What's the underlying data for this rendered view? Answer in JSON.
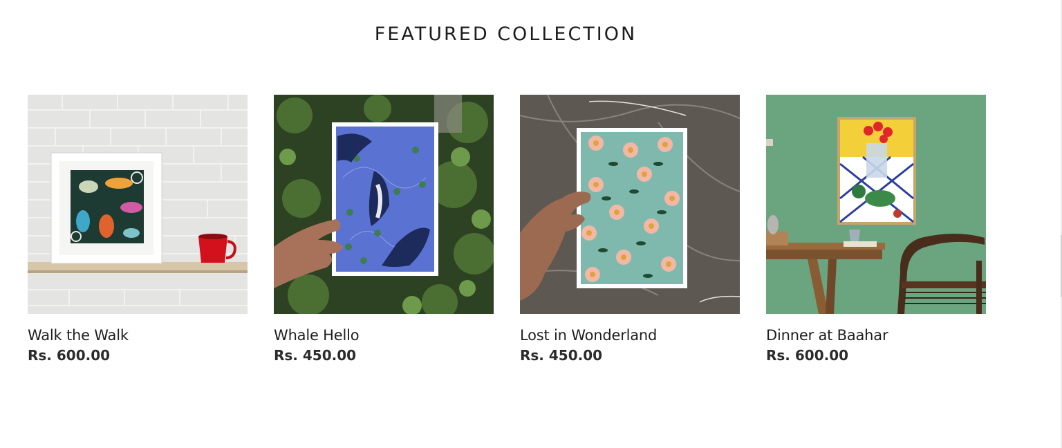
{
  "section": {
    "title": "FEATURED COLLECTION"
  },
  "products": [
    {
      "title": "Walk the Walk",
      "price": "Rs. 600.00",
      "image_icon": "framed-art-on-shelf-image"
    },
    {
      "title": "Whale Hello",
      "price": "Rs. 450.00",
      "image_icon": "whale-card-in-hand-image"
    },
    {
      "title": "Lost in Wonderland",
      "price": "Rs. 450.00",
      "image_icon": "floral-card-in-hand-image"
    },
    {
      "title": "Dinner at Baahar",
      "price": "Rs. 600.00",
      "image_icon": "framed-art-in-dining-room-image"
    }
  ],
  "colors": {
    "background": "#ffffff",
    "text": "#1a1a1a",
    "brick_wall": "#e6e6e6",
    "foliage": "#2f4a24",
    "card_blue": "#5a72d2",
    "marble": "#5c5652",
    "card_mint": "#7fb9ae",
    "wall_green": "#6aa57f"
  }
}
